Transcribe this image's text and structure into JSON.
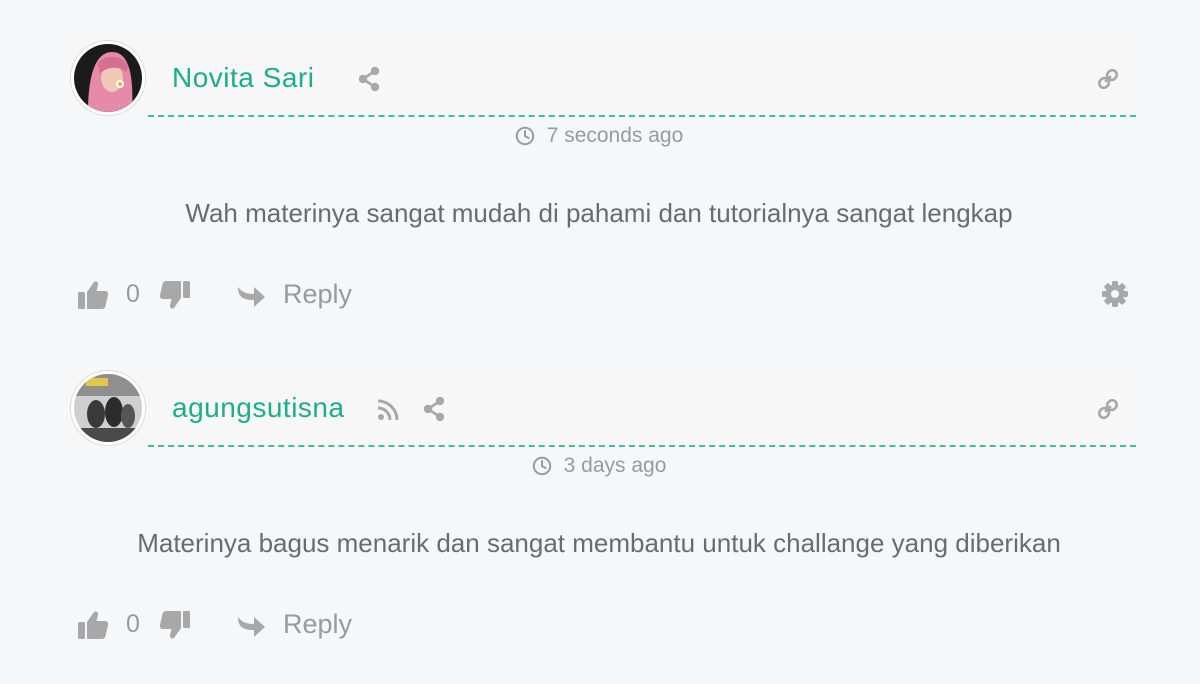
{
  "comments": [
    {
      "author": "Novita Sari",
      "time": "7 seconds ago",
      "text": "Wah materinya sangat mudah di pahami dan tutorialnya sangat lengkap",
      "votes": "0",
      "reply_label": "Reply",
      "has_rss": false,
      "has_settings": true
    },
    {
      "author": "agungsutisna",
      "time": "3 days ago",
      "text": "Materinya bagus menarik dan sangat membantu untuk challange yang diberikan",
      "votes": "0",
      "reply_label": "Reply",
      "has_rss": true,
      "has_settings": false
    }
  ],
  "colors": {
    "accent": "#1aae8a",
    "dashed_line": "#3cc0a0",
    "icon_gray": "#a8a8a8",
    "text_gray": "#6b6b6b"
  },
  "icons": [
    "share-icon",
    "link-icon",
    "clock-icon",
    "thumbs-up-icon",
    "thumbs-down-icon",
    "reply-arrow-icon",
    "gear-icon",
    "rss-icon"
  ]
}
